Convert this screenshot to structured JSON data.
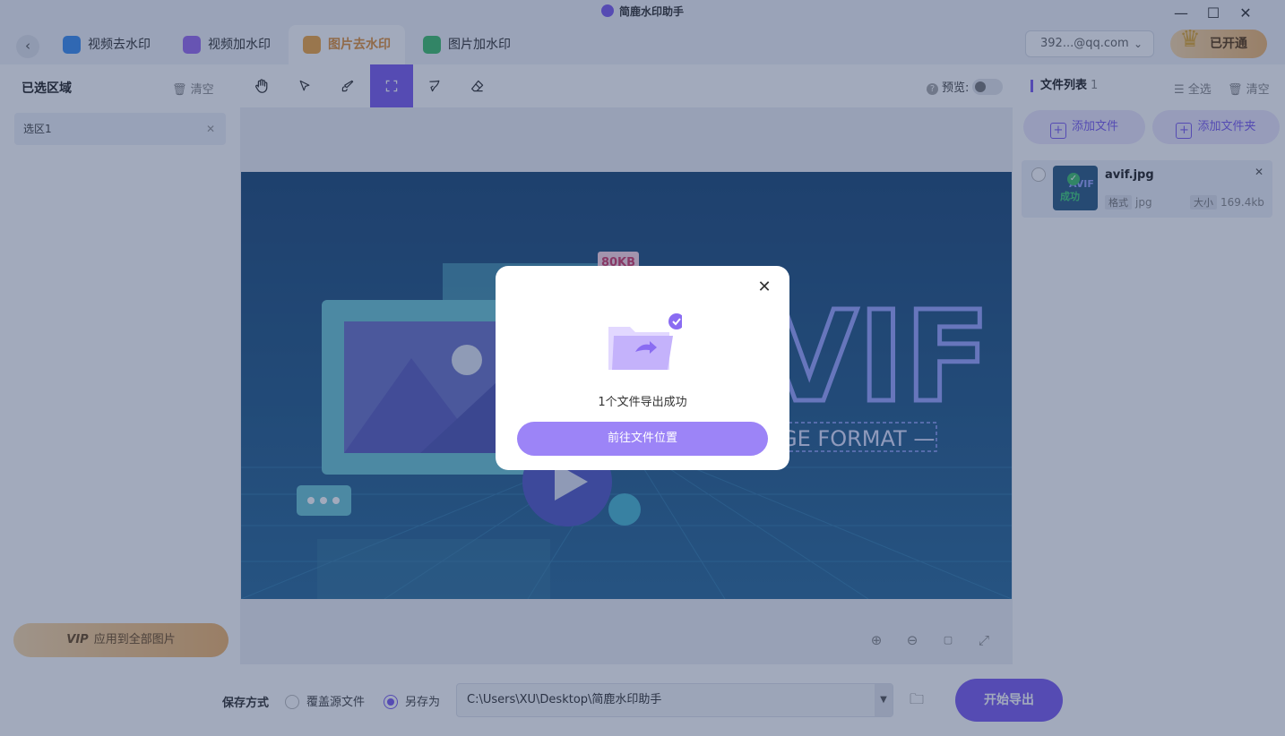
{
  "window": {
    "title": "简鹿水印助手"
  },
  "tabs": [
    {
      "label": "视频去水印"
    },
    {
      "label": "视频加水印"
    },
    {
      "label": "图片去水印"
    },
    {
      "label": "图片加水印"
    }
  ],
  "account": {
    "email": "392...@qq.com",
    "vip_label": "已开通",
    "vip_badge": "VIP"
  },
  "left_panel": {
    "title": "已选区域",
    "clear_label": "清空",
    "selections": [
      {
        "label": "选区1"
      }
    ],
    "apply_vip": "VIP",
    "apply_label": "应用到全部图片"
  },
  "toolbar": {
    "tools": [
      "hand-icon",
      "pointer-icon",
      "brush-icon",
      "rect-select-icon",
      "lasso-icon",
      "eraser-icon"
    ],
    "preview_label": "预览:"
  },
  "canvas": {
    "badge": "80KB",
    "big_text": "VIF",
    "format_text": "GE FORMAT —"
  },
  "right_panel": {
    "title": "文件列表",
    "count": "1",
    "select_all": "全选",
    "clear": "清空",
    "add_file": "添加文件",
    "add_folder": "添加文件夹",
    "files": [
      {
        "name": "avif.jpg",
        "thumb_text": "AVIF",
        "status": "成功",
        "format_label": "格式",
        "format": "jpg",
        "size_label": "大小",
        "size": "169.4kb"
      }
    ]
  },
  "bottom": {
    "save_label": "保存方式",
    "overwrite_label": "覆盖源文件",
    "save_as_label": "另存为",
    "save_as_selected": true,
    "path": "C:\\Users\\XU\\Desktop\\简鹿水印助手",
    "export_label": "开始导出"
  },
  "modal": {
    "message": "1个文件导出成功",
    "button_label": "前往文件位置"
  },
  "colors": {
    "accent": "#7a5cf0",
    "tab_active": "#e1923a",
    "vip_gold": "#efb66e",
    "success": "#3fbf6b"
  }
}
